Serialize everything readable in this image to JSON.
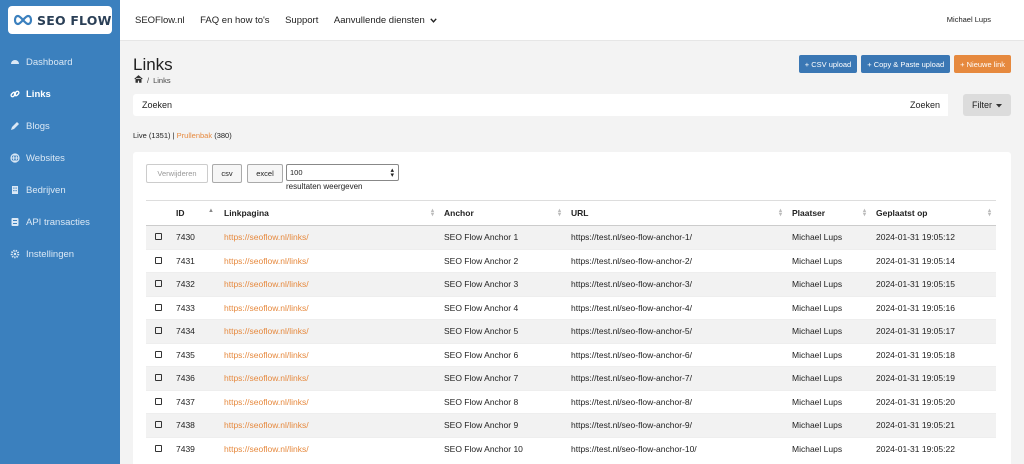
{
  "brand": {
    "name": "SEO FLOW"
  },
  "colors": {
    "sidebar": "#3b80be",
    "accent_orange": "#e6893e",
    "button_blue": "#3a77b4"
  },
  "sidebar": {
    "items": [
      {
        "label": "Dashboard",
        "icon": "dashboard-icon",
        "active": false
      },
      {
        "label": "Links",
        "icon": "link-icon",
        "active": true
      },
      {
        "label": "Blogs",
        "icon": "pencil-icon",
        "active": false
      },
      {
        "label": "Websites",
        "icon": "globe-icon",
        "active": false
      },
      {
        "label": "Bedrijven",
        "icon": "building-icon",
        "active": false
      },
      {
        "label": "API transacties",
        "icon": "server-icon",
        "active": false
      },
      {
        "label": "Instellingen",
        "icon": "gear-icon",
        "active": false
      }
    ]
  },
  "topnav": {
    "items": [
      "SEOFlow.nl",
      "FAQ en how to's",
      "Support",
      "Aanvullende diensten"
    ],
    "user": "Michael Lups"
  },
  "page": {
    "title": "Links",
    "breadcrumb": "Links",
    "buttons": {
      "csv_upload": "+ CSV upload",
      "copy_paste": "+ Copy & Paste upload",
      "new_link": "+ Nieuwe link"
    }
  },
  "search": {
    "placeholder": "Zoeken",
    "button": "Zoeken",
    "filter": "Filter"
  },
  "status": {
    "live_label": "Live (1351)",
    "sep": " | ",
    "trash_label": "Prullenbak",
    "trash_count": " (380)"
  },
  "controls": {
    "delete": "Verwijderen",
    "csv": "csv",
    "excel": "excel",
    "per_page": "100",
    "per_page_label": "resultaten weergeven"
  },
  "table": {
    "headers": [
      "ID",
      "Linkpagina",
      "Anchor",
      "URL",
      "Plaatser",
      "Geplaatst op"
    ],
    "rows": [
      {
        "id": "7430",
        "page": "https://seoflow.nl/links/",
        "anchor": "SEO Flow Anchor 1",
        "url": "https://test.nl/seo-flow-anchor-1/",
        "user": "Michael Lups",
        "date": "2024-01-31 19:05:12"
      },
      {
        "id": "7431",
        "page": "https://seoflow.nl/links/",
        "anchor": "SEO Flow Anchor 2",
        "url": "https://test.nl/seo-flow-anchor-2/",
        "user": "Michael Lups",
        "date": "2024-01-31 19:05:14"
      },
      {
        "id": "7432",
        "page": "https://seoflow.nl/links/",
        "anchor": "SEO Flow Anchor 3",
        "url": "https://test.nl/seo-flow-anchor-3/",
        "user": "Michael Lups",
        "date": "2024-01-31 19:05:15"
      },
      {
        "id": "7433",
        "page": "https://seoflow.nl/links/",
        "anchor": "SEO Flow Anchor 4",
        "url": "https://test.nl/seo-flow-anchor-4/",
        "user": "Michael Lups",
        "date": "2024-01-31 19:05:16"
      },
      {
        "id": "7434",
        "page": "https://seoflow.nl/links/",
        "anchor": "SEO Flow Anchor 5",
        "url": "https://test.nl/seo-flow-anchor-5/",
        "user": "Michael Lups",
        "date": "2024-01-31 19:05:17"
      },
      {
        "id": "7435",
        "page": "https://seoflow.nl/links/",
        "anchor": "SEO Flow Anchor 6",
        "url": "https://test.nl/seo-flow-anchor-6/",
        "user": "Michael Lups",
        "date": "2024-01-31 19:05:18"
      },
      {
        "id": "7436",
        "page": "https://seoflow.nl/links/",
        "anchor": "SEO Flow Anchor 7",
        "url": "https://test.nl/seo-flow-anchor-7/",
        "user": "Michael Lups",
        "date": "2024-01-31 19:05:19"
      },
      {
        "id": "7437",
        "page": "https://seoflow.nl/links/",
        "anchor": "SEO Flow Anchor 8",
        "url": "https://test.nl/seo-flow-anchor-8/",
        "user": "Michael Lups",
        "date": "2024-01-31 19:05:20"
      },
      {
        "id": "7438",
        "page": "https://seoflow.nl/links/",
        "anchor": "SEO Flow Anchor 9",
        "url": "https://test.nl/seo-flow-anchor-9/",
        "user": "Michael Lups",
        "date": "2024-01-31 19:05:21"
      },
      {
        "id": "7439",
        "page": "https://seoflow.nl/links/",
        "anchor": "SEO Flow Anchor 10",
        "url": "https://test.nl/seo-flow-anchor-10/",
        "user": "Michael Lups",
        "date": "2024-01-31 19:05:22"
      }
    ]
  }
}
